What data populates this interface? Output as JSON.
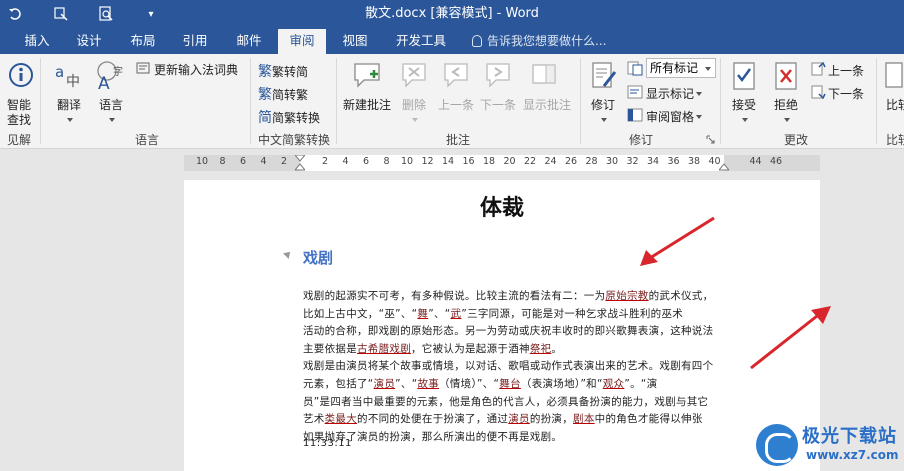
{
  "window": {
    "title": "散文.docx [兼容模式] - Word"
  },
  "quick_access": {
    "undo_icon": "undo-icon",
    "touch_icon": "touch-mode-icon",
    "print_preview_icon": "print-preview-icon",
    "customize": "▾"
  },
  "tabs": [
    {
      "label": "插入"
    },
    {
      "label": "设计"
    },
    {
      "label": "布局"
    },
    {
      "label": "引用"
    },
    {
      "label": "邮件"
    },
    {
      "label": "审阅"
    },
    {
      "label": "视图"
    },
    {
      "label": "开发工具"
    }
  ],
  "tell_me": {
    "placeholder": "告诉我您想要做什么..."
  },
  "ribbon": {
    "proofing": {
      "smart_lookup_1": "智能",
      "smart_lookup_2": "查找",
      "group": "见解"
    },
    "language": {
      "translate": "翻译",
      "language": "语言",
      "update_ime": "更新输入法词典",
      "group": "语言"
    },
    "chinese": {
      "t2s": "繁转简",
      "s2t": "简转繁",
      "convert": "简繁转换",
      "group": "中文简繁转换"
    },
    "comments": {
      "new": "新建批注",
      "delete": "删除",
      "prev": "上一条",
      "next": "下一条",
      "show": "显示批注",
      "group": "批注"
    },
    "tracking": {
      "track": "修订",
      "all_markup": "所有标记",
      "show_markup": "显示标记",
      "review_pane": "审阅窗格",
      "group": "修订"
    },
    "changes": {
      "accept": "接受",
      "reject": "拒绝",
      "prev": "上一条",
      "next": "下一条",
      "group": "更改",
      "compare": "比较",
      "group2": "比较"
    }
  },
  "ruler": {
    "ticks": [
      "10",
      "8",
      "6",
      "4",
      "2",
      "",
      "2",
      "4",
      "6",
      "8",
      "10",
      "12",
      "14",
      "16",
      "18",
      "20",
      "22",
      "24",
      "26",
      "28",
      "30",
      "32",
      "34",
      "36",
      "38",
      "40",
      "",
      "44",
      "46"
    ]
  },
  "document": {
    "title": "体裁",
    "heading": "戏剧",
    "lines": [
      [
        "戏剧的起源实不可考，有多种假说。比较主流的看法有二：一为",
        "原始宗教",
        "的武术仪式，"
      ],
      [
        "比如上古中文，“巫”、“",
        "舞",
        "”、“",
        "武",
        "”三字同源，可能是对一种乞求战斗胜利的巫术"
      ],
      [
        "活动的合称，即戏剧的原始形态。另一为劳动或庆祝丰收时的即兴歌舞表演，这种说法"
      ],
      [
        "主要依据是",
        "古希腊戏剧",
        "，它被认为是起源于酒神",
        "祭祀",
        "。"
      ],
      [
        "戏剧是由演员将某个故事或情境，以对话、歌唱或动作式表演出来的艺术。戏剧有四个"
      ],
      [
        "元素，包括了“",
        "演员",
        "”、“",
        "故事",
        "（情境）”、“",
        "舞台",
        "（表演场地）”和“",
        "观众",
        "”。“演"
      ],
      [
        "员”是四者当中最重要的元素，他是角色的代言人，必须具备扮演的能力，戏剧与其它"
      ],
      [
        "艺术",
        "类最大",
        "的不同的处便在于扮演了，通过",
        "演员",
        "的扮演，",
        "剧本",
        "中的角色才能得以伸张"
      ],
      [
        "如果抛弃了演员的扮演，那么所演出的便不再是戏剧。"
      ]
    ],
    "timestamp": "11:33:11"
  },
  "watermark": {
    "brand": "极光下载站",
    "url": "www.xz7.com"
  },
  "colors": {
    "accent": "#2b579a",
    "arrow": "#d9262c",
    "heading": "#4472c4"
  }
}
